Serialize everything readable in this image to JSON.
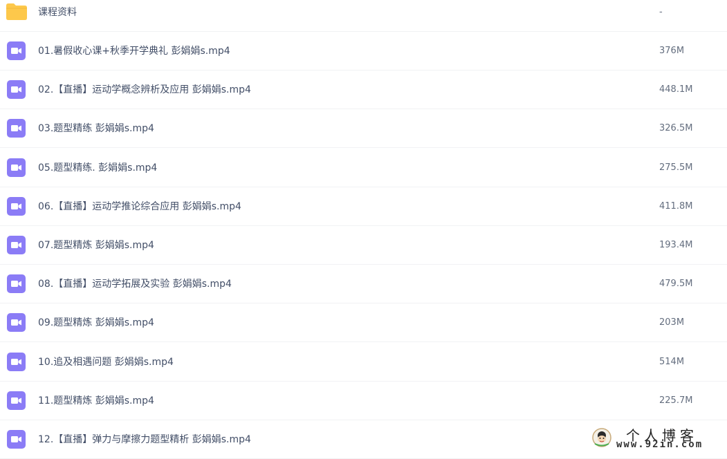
{
  "folder": {
    "name": "课程资料",
    "size": "-"
  },
  "files": [
    {
      "name": "01.暑假收心课+秋季开学典礼 彭娟娟s.mp4",
      "size": "376M"
    },
    {
      "name": "02.【直播】运动学概念辨析及应用 彭娟娟s.mp4",
      "size": "448.1M"
    },
    {
      "name": "03.题型精练 彭娟娟s.mp4",
      "size": "326.5M"
    },
    {
      "name": "05.题型精练. 彭娟娟s.mp4",
      "size": "275.5M"
    },
    {
      "name": "06.【直播】运动学推论综合应用 彭娟娟s.mp4",
      "size": "411.8M"
    },
    {
      "name": "07.题型精炼 彭娟娟s.mp4",
      "size": "193.4M"
    },
    {
      "name": "08.【直播】运动学拓展及实验 彭娟娟s.mp4",
      "size": "479.5M"
    },
    {
      "name": "09.题型精炼 彭娟娟s.mp4",
      "size": "203M"
    },
    {
      "name": "10.追及相遇问题 彭娟娟s.mp4",
      "size": "514M"
    },
    {
      "name": "11.题型精炼 彭娟娟s.mp4",
      "size": "225.7M"
    },
    {
      "name": "12.【直播】弹力与摩擦力题型精析 彭娟娟s.mp4",
      "size": ""
    }
  ],
  "watermark": {
    "title": "个人博客",
    "url": "www.92in.com"
  },
  "colors": {
    "folder": "#fdc84b",
    "video": "#8b7cf6",
    "text": "#424e67",
    "size_text": "#636d7e",
    "divider": "#f1f2f4"
  },
  "icons": {
    "folder": "folder-icon",
    "video": "video-file-icon"
  }
}
